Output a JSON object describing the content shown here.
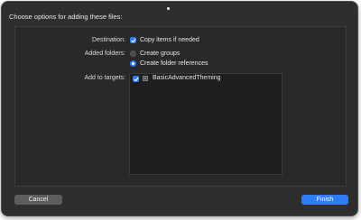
{
  "dialog": {
    "title": "Choose options for adding these files:"
  },
  "destination": {
    "label": "Destination:",
    "option_label": "Copy items if needed",
    "checked": true
  },
  "added_folders": {
    "label": "Added folders:",
    "options": [
      {
        "label": "Create groups",
        "selected": false
      },
      {
        "label": "Create folder references",
        "selected": true
      }
    ]
  },
  "targets": {
    "label": "Add to targets:",
    "items": [
      {
        "name": "BasicAdvancedTheming",
        "checked": true,
        "icon": "app-target-icon"
      }
    ]
  },
  "buttons": {
    "cancel_label": "Cancel",
    "finish_label": "Finish"
  },
  "colors": {
    "accent": "#2f7cf6",
    "sheet_background": "#2e2e2e",
    "list_background": "#1e1e1e"
  }
}
